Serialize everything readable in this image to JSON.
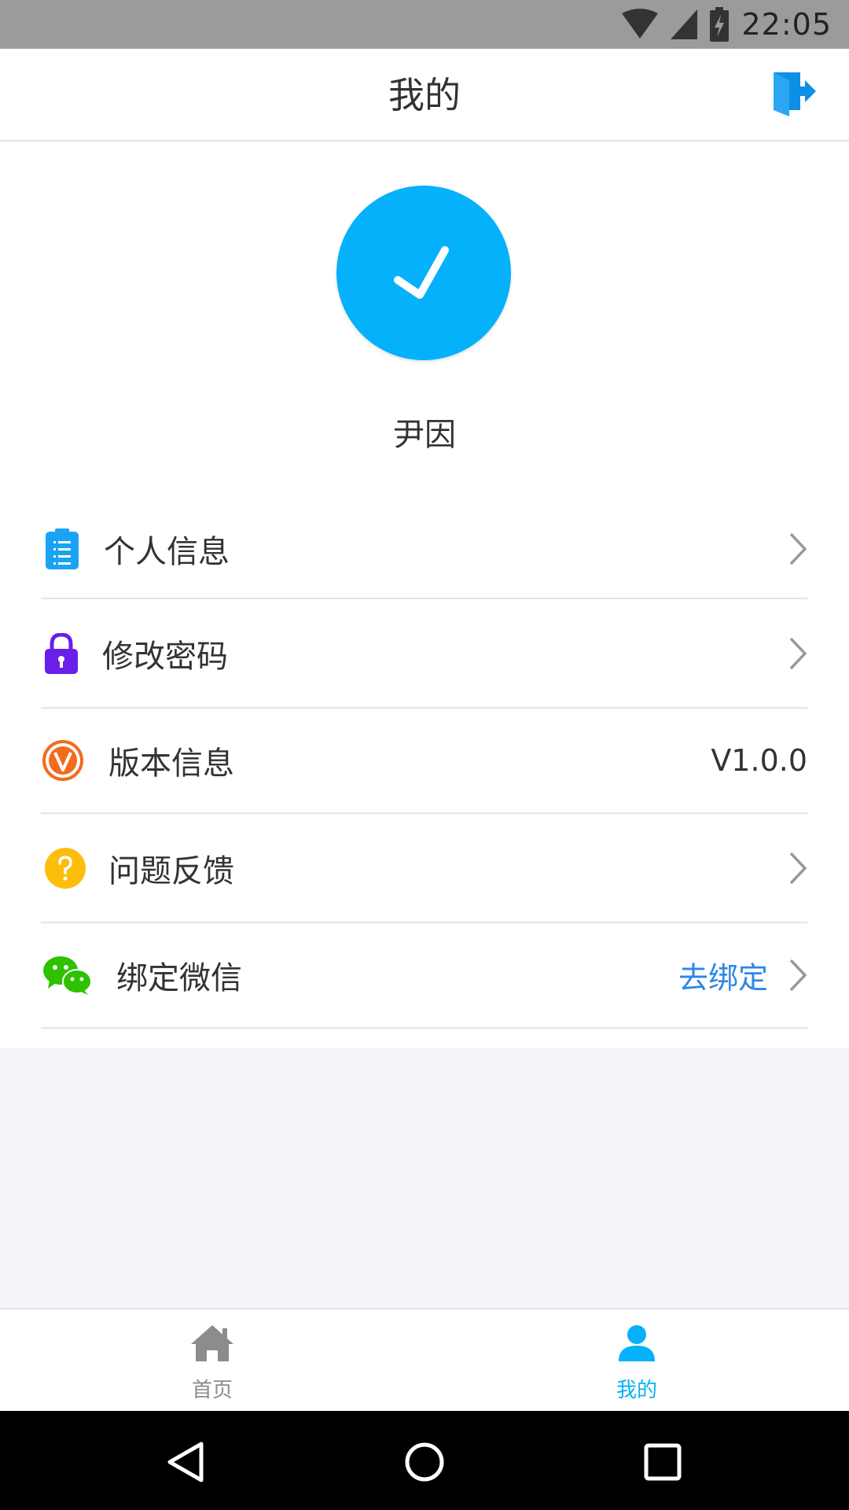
{
  "status_bar": {
    "time": "22:05"
  },
  "header": {
    "title": "我的"
  },
  "profile": {
    "name": "尹因"
  },
  "menu": {
    "items": [
      {
        "label": "个人信息"
      },
      {
        "label": "修改密码"
      },
      {
        "label": "版本信息",
        "value": "V1.0.0"
      },
      {
        "label": "问题反馈"
      },
      {
        "label": "绑定微信",
        "action": "去绑定"
      }
    ]
  },
  "tabs": [
    {
      "label": "首页",
      "icon": "home-icon",
      "active": false
    },
    {
      "label": "我的",
      "icon": "user-icon",
      "active": true
    }
  ],
  "colors": {
    "accent": "#06b1fb",
    "link": "#2f86e6",
    "tab_inactive": "#8c8c8c",
    "lock": "#6a1fe8",
    "version": "#f36b1d",
    "feedback": "#fdbd0b",
    "wechat": "#2dc100"
  }
}
